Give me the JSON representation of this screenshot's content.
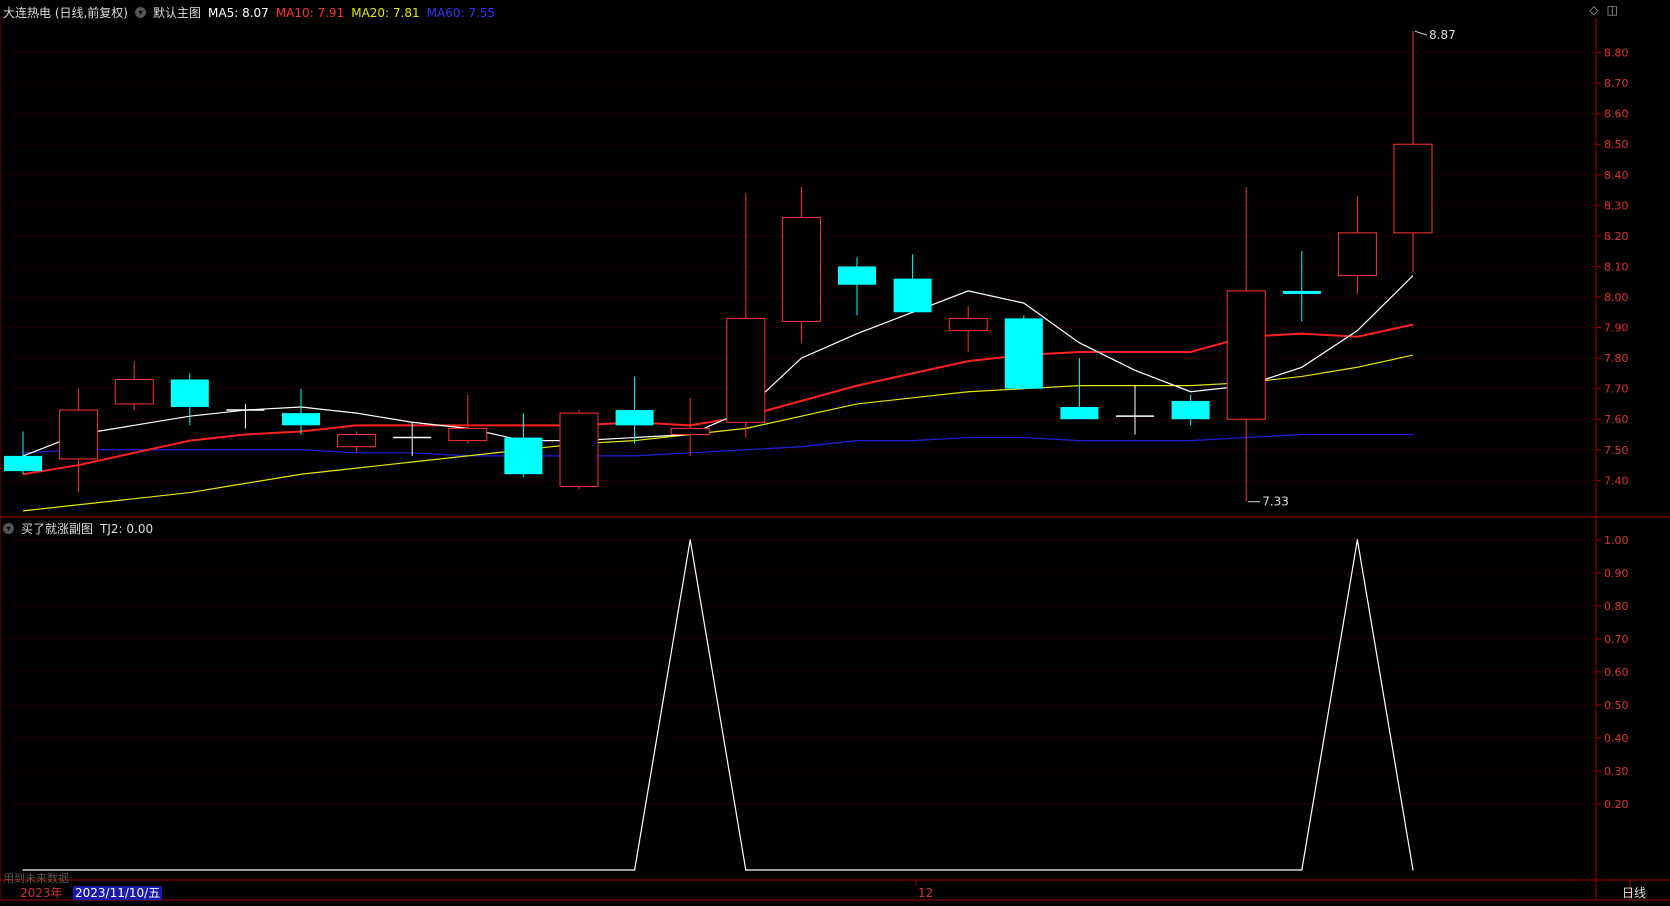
{
  "main_title": {
    "stock": "大连热电 (日线,前复权)",
    "template": "默认主图",
    "ma5": "MA5: 8.07",
    "ma10": "MA10: 7.91",
    "ma20": "MA20: 7.81",
    "ma60": "MA60: 7.55"
  },
  "sub_title": {
    "name": "买了就涨副图",
    "tj2": "TJ2: 0.00"
  },
  "footer": {
    "note": "用到未来数据",
    "year": "2023年",
    "date": "2023/11/10/五",
    "month": "12",
    "period": "日线"
  },
  "colors": {
    "up": "#ff3232",
    "down": "#00ffff",
    "ma5": "#ffffff",
    "ma10": "#ff2020",
    "ma20": "#e6e600",
    "ma60": "#2020dd",
    "axis": "#aa0000"
  },
  "chart_data": [
    {
      "type": "candlestick",
      "ylim": [
        7.28,
        8.9
      ],
      "y_ticks": [
        "8.80",
        "8.70",
        "8.60",
        "8.50",
        "8.40",
        "8.30",
        "8.20",
        "8.10",
        "8.00",
        "7.90",
        "7.80",
        "7.70",
        "7.60",
        "7.50",
        "7.40"
      ],
      "candles": [
        {
          "o": 7.48,
          "h": 7.56,
          "l": 7.42,
          "c": 7.43
        },
        {
          "o": 7.47,
          "h": 7.7,
          "l": 7.36,
          "c": 7.63
        },
        {
          "o": 7.65,
          "h": 7.79,
          "l": 7.63,
          "c": 7.73
        },
        {
          "o": 7.73,
          "h": 7.75,
          "l": 7.58,
          "c": 7.64
        },
        {
          "o": 7.63,
          "h": 7.65,
          "l": 7.57,
          "c": 7.63
        },
        {
          "o": 7.62,
          "h": 7.7,
          "l": 7.55,
          "c": 7.58
        },
        {
          "o": 7.51,
          "h": 7.56,
          "l": 7.49,
          "c": 7.55
        },
        {
          "o": 7.54,
          "h": 7.59,
          "l": 7.48,
          "c": 7.54
        },
        {
          "o": 7.53,
          "h": 7.68,
          "l": 7.52,
          "c": 7.57
        },
        {
          "o": 7.54,
          "h": 7.62,
          "l": 7.41,
          "c": 7.42
        },
        {
          "o": 7.38,
          "h": 7.63,
          "l": 7.37,
          "c": 7.62
        },
        {
          "o": 7.63,
          "h": 7.74,
          "l": 7.52,
          "c": 7.58
        },
        {
          "o": 7.55,
          "h": 7.67,
          "l": 7.48,
          "c": 7.57
        },
        {
          "o": 7.59,
          "h": 8.34,
          "l": 7.54,
          "c": 7.93
        },
        {
          "o": 7.92,
          "h": 8.36,
          "l": 7.85,
          "c": 8.26
        },
        {
          "o": 8.1,
          "h": 8.13,
          "l": 7.94,
          "c": 8.04
        },
        {
          "o": 8.06,
          "h": 8.14,
          "l": 7.95,
          "c": 7.95
        },
        {
          "o": 7.89,
          "h": 7.97,
          "l": 7.82,
          "c": 7.93
        },
        {
          "o": 7.93,
          "h": 7.94,
          "l": 7.7,
          "c": 7.7
        },
        {
          "o": 7.64,
          "h": 7.8,
          "l": 7.6,
          "c": 7.6
        },
        {
          "o": 7.61,
          "h": 7.71,
          "l": 7.55,
          "c": 7.61
        },
        {
          "o": 7.66,
          "h": 7.68,
          "l": 7.58,
          "c": 7.6
        },
        {
          "o": 7.6,
          "h": 8.36,
          "l": 7.33,
          "c": 8.02
        },
        {
          "o": 8.02,
          "h": 8.15,
          "l": 7.92,
          "c": 8.01
        },
        {
          "o": 8.07,
          "h": 8.33,
          "l": 8.01,
          "c": 8.21
        },
        {
          "o": 8.21,
          "h": 8.87,
          "l": 8.08,
          "c": 8.5
        }
      ],
      "ma5": [
        7.48,
        7.55,
        7.58,
        7.61,
        7.63,
        7.64,
        7.62,
        7.59,
        7.57,
        7.53,
        7.53,
        7.54,
        7.55,
        7.63,
        7.8,
        7.88,
        7.95,
        8.02,
        7.98,
        7.85,
        7.76,
        7.69,
        7.71,
        7.77,
        7.89,
        8.07
      ],
      "ma10": [
        7.42,
        7.45,
        7.49,
        7.53,
        7.55,
        7.56,
        7.58,
        7.58,
        7.58,
        7.58,
        7.58,
        7.59,
        7.58,
        7.61,
        7.66,
        7.71,
        7.75,
        7.79,
        7.81,
        7.82,
        7.82,
        7.82,
        7.87,
        7.88,
        7.87,
        7.91
      ],
      "ma20": [
        7.3,
        7.32,
        7.34,
        7.36,
        7.39,
        7.42,
        7.44,
        7.46,
        7.48,
        7.5,
        7.52,
        7.53,
        7.55,
        7.57,
        7.61,
        7.65,
        7.67,
        7.69,
        7.7,
        7.71,
        7.71,
        7.71,
        7.72,
        7.74,
        7.77,
        7.81
      ],
      "ma60": [
        7.49,
        7.5,
        7.5,
        7.5,
        7.5,
        7.5,
        7.49,
        7.49,
        7.48,
        7.48,
        7.48,
        7.48,
        7.49,
        7.5,
        7.51,
        7.53,
        7.53,
        7.54,
        7.54,
        7.53,
        7.53,
        7.53,
        7.54,
        7.55,
        7.55,
        7.55
      ],
      "high_mark": {
        "index": 25,
        "value": 8.87,
        "label": "8.87"
      },
      "low_mark": {
        "index": 22,
        "value": 7.33,
        "label": "7.33"
      }
    },
    {
      "type": "line",
      "name": "TJ2",
      "ylim": [
        0,
        1.06
      ],
      "y_ticks": [
        "1.00",
        "0.90",
        "0.80",
        "0.70",
        "0.60",
        "0.50",
        "0.40",
        "0.30",
        "0.20"
      ],
      "values": [
        0,
        0,
        0,
        0,
        0,
        0,
        0,
        0,
        0,
        0,
        0,
        0,
        1,
        0,
        0,
        0,
        0,
        0,
        0,
        0,
        0,
        0,
        0,
        0,
        1,
        0
      ]
    }
  ]
}
